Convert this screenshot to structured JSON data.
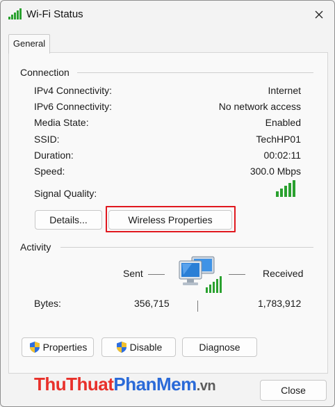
{
  "window": {
    "title": "Wi-Fi Status",
    "title_icon": "wifi-signal-icon",
    "close_icon": "close-icon"
  },
  "tabs": [
    {
      "label": "General",
      "selected": true
    }
  ],
  "connection": {
    "heading": "Connection",
    "rows": [
      {
        "label": "IPv4 Connectivity:",
        "value": "Internet"
      },
      {
        "label": "IPv6 Connectivity:",
        "value": "No network access"
      },
      {
        "label": "Media State:",
        "value": "Enabled"
      },
      {
        "label": "SSID:",
        "value": "TechHP01"
      },
      {
        "label": "Duration:",
        "value": "00:02:11"
      },
      {
        "label": "Speed:",
        "value": "300.0 Mbps"
      }
    ],
    "signal_label": "Signal Quality:",
    "signal_bars": 5,
    "buttons": {
      "details": "Details...",
      "wireless_properties": "Wireless Properties"
    }
  },
  "activity": {
    "heading": "Activity",
    "sent_label": "Sent",
    "received_label": "Received",
    "bytes_label": "Bytes:",
    "bytes_sent": "356,715",
    "bytes_received": "1,783,912",
    "network_icon": "network-computer-icon"
  },
  "bottom_buttons": {
    "properties": "Properties",
    "disable": "Disable",
    "diagnose": "Diagnose",
    "shield_icon": "uac-shield-icon"
  },
  "watermark": {
    "part1": "ThuThuat",
    "part2": "PhanMem",
    "part3": ".vn"
  },
  "footer": {
    "close": "Close"
  },
  "colors": {
    "highlight": "#e0181e",
    "signal_green": "#2aa12f",
    "monitor_blue": "#2a7fd6"
  }
}
